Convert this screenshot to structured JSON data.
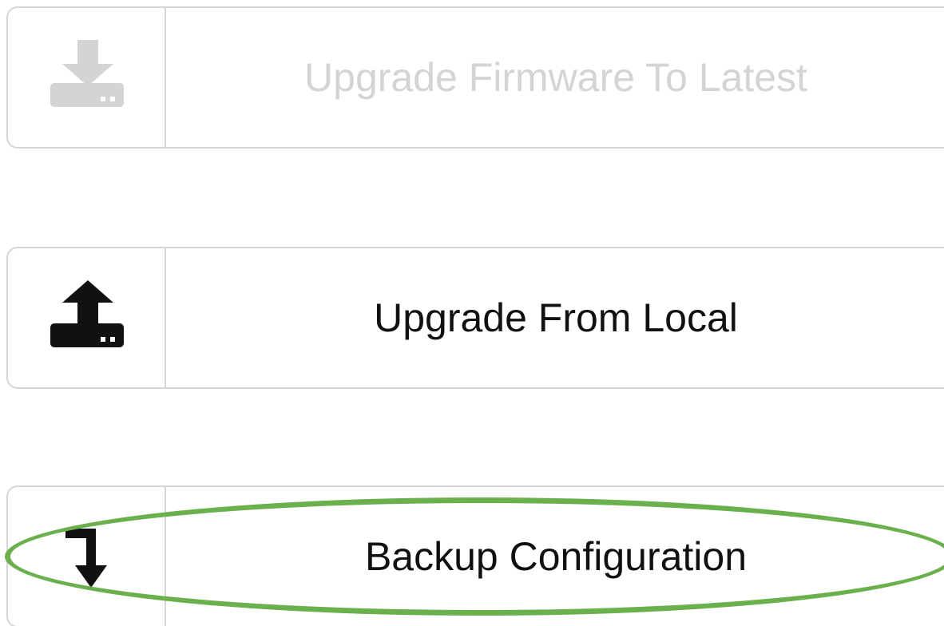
{
  "buttons": {
    "upgrade_firmware": {
      "label": "Upgrade Firmware To Latest",
      "icon": "download-icon",
      "state": "disabled",
      "color": "#d4d4d4"
    },
    "upgrade_local": {
      "label": "Upgrade From Local",
      "icon": "upload-icon",
      "state": "enabled",
      "color": "#111111"
    },
    "backup_config": {
      "label": "Backup Configuration",
      "icon": "down-arrow-icon",
      "state": "enabled",
      "color": "#111111",
      "highlighted": true
    }
  },
  "colors": {
    "border": "#d6d6d6",
    "highlight": "#6ab04c"
  }
}
